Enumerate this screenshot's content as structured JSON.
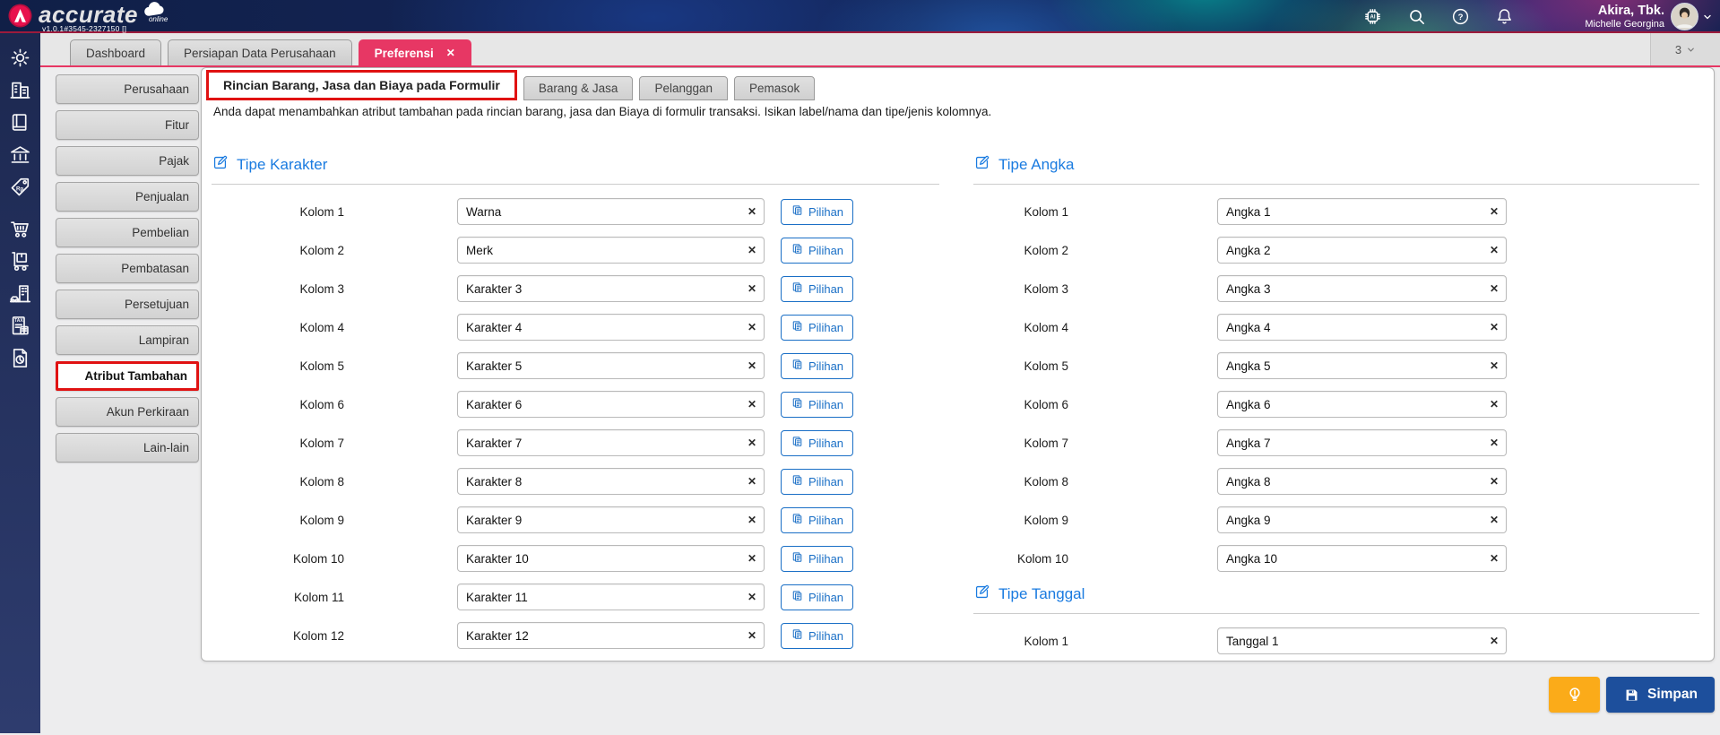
{
  "brand": {
    "name": "accurate",
    "sub": "online",
    "version": "v1.0.1#3545-2327150 []"
  },
  "header": {
    "icons": [
      "ai-assistant",
      "search",
      "help",
      "notifications"
    ],
    "user_company": "Akira, Tbk.",
    "user_name": "Michelle Georgina"
  },
  "window_tabs": [
    {
      "label": "Dashboard",
      "active": false
    },
    {
      "label": "Persiapan Data Perusahaan",
      "active": false
    },
    {
      "label": "Preferensi",
      "active": true,
      "close": "✕"
    }
  ],
  "tab_overflow": "3",
  "rail_icons": [
    "settings",
    "company",
    "journal",
    "banking",
    "price-tag",
    "purchases",
    "inventory",
    "fixed-assets",
    "taxes",
    "reports"
  ],
  "nav_sections": [
    {
      "label": "Perusahaan",
      "active": false
    },
    {
      "label": "Fitur",
      "active": false
    },
    {
      "label": "Pajak",
      "active": false
    },
    {
      "label": "Penjualan",
      "active": false
    },
    {
      "label": "Pembelian",
      "active": false
    },
    {
      "label": "Pembatasan",
      "active": false
    },
    {
      "label": "Persetujuan",
      "active": false
    },
    {
      "label": "Lampiran",
      "active": false
    },
    {
      "label": "Atribut Tambahan",
      "active": true
    },
    {
      "label": "Akun Perkiraan",
      "active": false
    },
    {
      "label": "Lain-lain",
      "active": false
    }
  ],
  "preferences": {
    "tabs": [
      {
        "label": "Rincian Barang, Jasa dan Biaya pada Formulir",
        "active": true,
        "annotated": true
      },
      {
        "label": "Barang & Jasa",
        "active": false
      },
      {
        "label": "Pelanggan",
        "active": false
      },
      {
        "label": "Pemasok",
        "active": false
      }
    ],
    "description": "Anda dapat menambahkan atribut tambahan pada rincian barang, jasa dan Biaya di formulir transaksi. Isikan label/nama dan tipe/jenis kolomnya.",
    "clear_icon": "✕",
    "option_button": "Pilihan",
    "sections": [
      {
        "id": "karakter",
        "title": "Tipe Karakter",
        "column": "left",
        "has_options": true,
        "rows": [
          {
            "label": "Kolom 1",
            "value": "Warna"
          },
          {
            "label": "Kolom 2",
            "value": "Merk"
          },
          {
            "label": "Kolom 3",
            "value": "Karakter 3"
          },
          {
            "label": "Kolom 4",
            "value": "Karakter 4"
          },
          {
            "label": "Kolom 5",
            "value": "Karakter 5"
          },
          {
            "label": "Kolom 6",
            "value": "Karakter 6"
          },
          {
            "label": "Kolom 7",
            "value": "Karakter 7"
          },
          {
            "label": "Kolom 8",
            "value": "Karakter 8"
          },
          {
            "label": "Kolom 9",
            "value": "Karakter 9"
          },
          {
            "label": "Kolom 10",
            "value": "Karakter 10"
          },
          {
            "label": "Kolom 11",
            "value": "Karakter 11"
          },
          {
            "label": "Kolom 12",
            "value": "Karakter 12"
          }
        ]
      },
      {
        "id": "angka",
        "title": "Tipe Angka",
        "column": "right",
        "has_options": false,
        "rows": [
          {
            "label": "Kolom 1",
            "value": "Angka 1"
          },
          {
            "label": "Kolom 2",
            "value": "Angka 2"
          },
          {
            "label": "Kolom 3",
            "value": "Angka 3"
          },
          {
            "label": "Kolom 4",
            "value": "Angka 4"
          },
          {
            "label": "Kolom 5",
            "value": "Angka 5"
          },
          {
            "label": "Kolom 6",
            "value": "Angka 6"
          },
          {
            "label": "Kolom 7",
            "value": "Angka 7"
          },
          {
            "label": "Kolom 8",
            "value": "Angka 8"
          },
          {
            "label": "Kolom 9",
            "value": "Angka 9"
          },
          {
            "label": "Kolom 10",
            "value": "Angka 10"
          }
        ]
      },
      {
        "id": "tanggal",
        "title": "Tipe Tanggal",
        "column": "right",
        "has_options": false,
        "rows": [
          {
            "label": "Kolom 1",
            "value": "Tanggal 1"
          }
        ]
      }
    ]
  },
  "footer": {
    "save": "Simpan"
  },
  "colors": {
    "accent_pink": "#e73764",
    "accent_blue": "#1a7be0",
    "button_blue": "#1d4f9c",
    "button_orange": "#fbab19",
    "annotation_red": "#e01212",
    "sidebar_navy": "#1c2850"
  }
}
